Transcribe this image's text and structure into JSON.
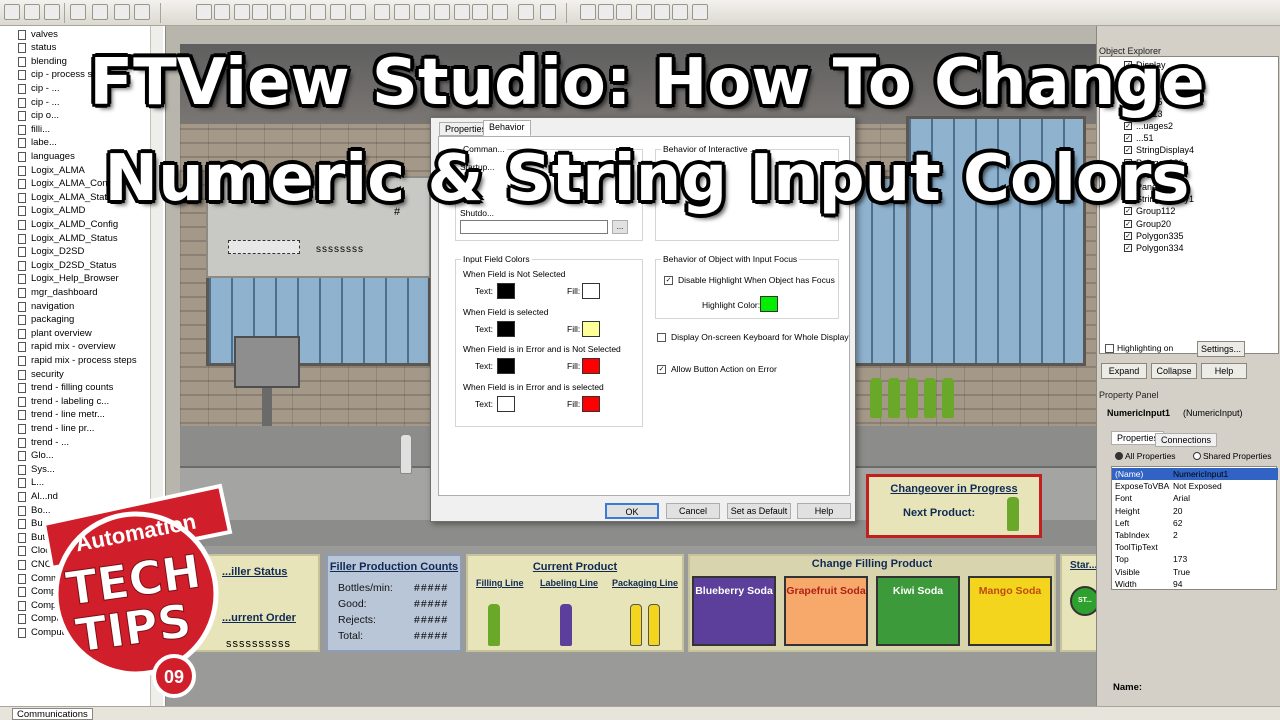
{
  "overlay": {
    "line1": "FTView Studio: How To Change",
    "line2": "Numeric & String Input Colors"
  },
  "logo": {
    "top": "Automation",
    "middle1": "TECH",
    "middle2": "TIPS",
    "number": "09"
  },
  "explorer": {
    "items": [
      "valves",
      "status",
      "blending",
      "cip - process steps",
      "cip - ...",
      "cip - ...",
      "cip o...",
      "filli...",
      "labe...",
      "languages",
      "Logix_ALMA",
      "Logix_ALMA_Config",
      "Logix_ALMA_Status",
      "Logix_ALMD",
      "Logix_ALMD_Config",
      "Logix_ALMD_Status",
      "Logix_D2SD",
      "Logix_D2SD_Status",
      "Logix_Help_Browser",
      "mgr_dashboard",
      "navigation",
      "packaging",
      "plant overview",
      "rapid mix - overview",
      "rapid mix - process steps",
      "security",
      "trend - filling counts",
      "trend - labeling c...",
      "trend - line metr...",
      "trend - line pr...",
      "trend - ...",
      "Glo...",
      "Sys...",
      "L...",
      "Al...nd",
      "Bo...",
      "Bu... - In...",
      "Butto...",
      "Clocks",
      "CNC Equi...",
      "Commun...",
      "Comp...",
      "Comp...",
      "Computer ... ters",
      "Computer - Workstations"
    ],
    "status_tab": "Communications"
  },
  "dialog": {
    "tabs": [
      "Properties",
      "Behavior"
    ],
    "command_group": "Comman...",
    "startup_label": "Startup...",
    "shutdown_label": "Shutdo...",
    "behavior_interactive": "Behavior of Interactive ...",
    "input_colors_title": "Input Field Colors",
    "sections": [
      {
        "title": "When Field is Not Selected",
        "text_label": "Text:",
        "fill_label": "Fill:",
        "text_color": "#000000",
        "fill_color": "#ffffff"
      },
      {
        "title": "When Field is selected",
        "text_label": "Text:",
        "fill_label": "Fill:",
        "text_color": "#000000",
        "fill_color": "#ffff99"
      },
      {
        "title": "When Field is in Error and is Not Selected",
        "text_label": "Text:",
        "fill_label": "Fill:",
        "text_color": "#000000",
        "fill_color": "#ff0000"
      },
      {
        "title": "When Field is in Error and is selected",
        "text_label": "Text:",
        "fill_label": "Fill:",
        "text_color": "#ffffff",
        "fill_color": "#ff0000"
      }
    ],
    "focus_group": "Behavior of Object with Input Focus",
    "disable_highlight": "Disable Highlight When Object has Focus",
    "highlight_color_label": "Highlight Color:",
    "highlight_color": "#00ee00",
    "onscreen_keyboard": "Display On-screen Keyboard for Whole Display",
    "allow_button": "Allow Button Action on Error",
    "buttons": {
      "ok": "OK",
      "cancel": "Cancel",
      "set_default": "Set as Default",
      "help": "Help"
    }
  },
  "hmi": {
    "machine_string": "ssssssss",
    "machine_hash": "#",
    "changeover_title": "Changeover in Progress",
    "next_product": "Next Product:",
    "filler_status": "...iller Status",
    "current_order": "...urrent Order",
    "order_value": "ssssssssss",
    "counts_title": "Filler Production Counts",
    "counts": [
      {
        "label": "Bottles/min:",
        "value": "#####"
      },
      {
        "label": "Good:",
        "value": "#####"
      },
      {
        "label": "Rejects:",
        "value": "#####"
      },
      {
        "label": "Total:",
        "value": "#####"
      }
    ],
    "current_product_title": "Current Product",
    "lines": [
      "Filling Line",
      "Labeling Line",
      "Packaging Line"
    ],
    "change_title": "Change Filling Product",
    "products": [
      {
        "name": "Blueberry Soda",
        "bg": "#5b3f9a",
        "fg": "#ffffff"
      },
      {
        "name": "Grapefruit Soda",
        "bg": "#f6a96a",
        "fg": "#b3201a"
      },
      {
        "name": "Kiwi Soda",
        "bg": "#3c9a3a",
        "fg": "#ffffff"
      },
      {
        "name": "Mango Soda",
        "bg": "#f2d51c",
        "fg": "#c04a10"
      }
    ],
    "start_label": "Star...",
    "start_btn": "ST..."
  },
  "object_explorer": {
    "title": "Object Explorer",
    "items": [
      "Display",
      "...",
      "...",
      "Text15",
      "Text13",
      "...uages2",
      "...51",
      "StringDisplay4",
      "Polygon336",
      "Group148",
      "Panel6",
      "StringDisplay1",
      "Group112",
      "Group20",
      "Polygon335",
      "Polygon334"
    ],
    "highlighting": "Highlighting on",
    "settings": "Settings...",
    "expand": "Expand",
    "collapse": "Collapse",
    "help": "Help"
  },
  "property_panel": {
    "title": "Property Panel",
    "object": "NumericInput1",
    "object_type": "(NumericInput)",
    "tabs": [
      "Properties",
      "Connections"
    ],
    "radio_all": "All Properties",
    "radio_shared": "Shared Properties",
    "rows": [
      {
        "k": "(Name)",
        "v": "NumericInput1"
      },
      {
        "k": "ExposeToVBA",
        "v": "Not Exposed"
      },
      {
        "k": "Font",
        "v": "Arial"
      },
      {
        "k": "Height",
        "v": "20"
      },
      {
        "k": "Left",
        "v": "62"
      },
      {
        "k": "TabIndex",
        "v": "2"
      },
      {
        "k": "ToolTipText",
        "v": ""
      },
      {
        "k": "Top",
        "v": "173"
      },
      {
        "k": "Visible",
        "v": "True"
      },
      {
        "k": "Width",
        "v": "94"
      }
    ],
    "name_label": "Name:"
  }
}
